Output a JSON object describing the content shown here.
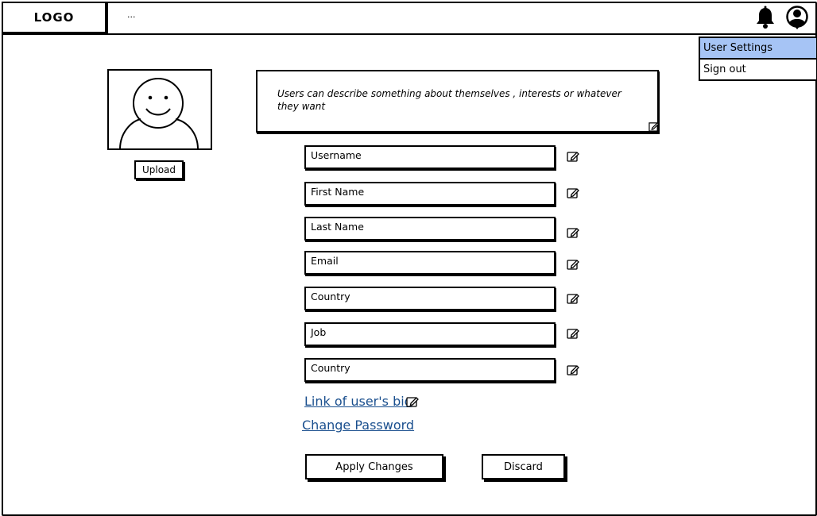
{
  "header": {
    "logo": "LOGO",
    "ellipsis": "...",
    "icons": [
      "bell-icon",
      "user-circle-icon"
    ]
  },
  "dropdown": {
    "items": [
      {
        "label": "User Settings",
        "active": true
      },
      {
        "label": "Sign out",
        "active": false
      }
    ],
    "active_color": "#a6c4f5"
  },
  "profile": {
    "upload_label": "Upload",
    "bio": "Users can describe something about themselves , interests or whatever they want"
  },
  "fields": [
    {
      "label": "Username"
    },
    {
      "label": "First Name"
    },
    {
      "label": "Last Name"
    },
    {
      "label": "Email"
    },
    {
      "label": "Country"
    },
    {
      "label": "Job"
    },
    {
      "label": "Country"
    }
  ],
  "links": {
    "bio_link": "Link of user's bio",
    "change_password": "Change Password",
    "color": "#1a4f8e"
  },
  "actions": {
    "apply": "Apply Changes",
    "discard": "Discard"
  }
}
